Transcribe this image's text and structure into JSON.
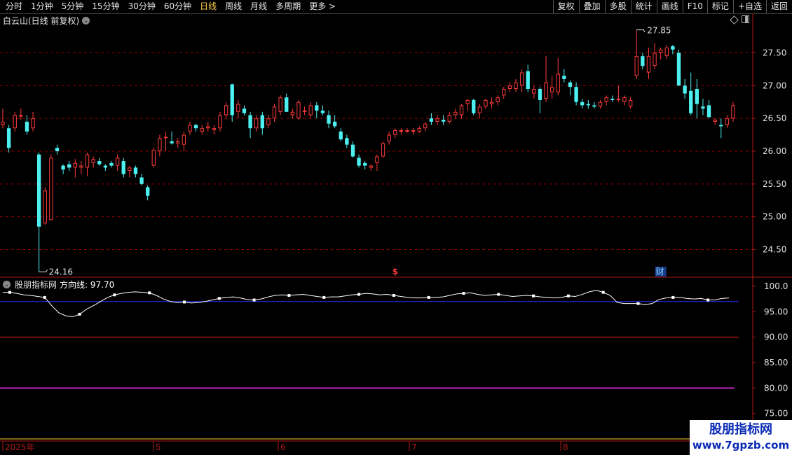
{
  "toolbar": {
    "periods": [
      "分时",
      "1分钟",
      "5分钟",
      "15分钟",
      "30分钟",
      "60分钟",
      "日线",
      "周线",
      "月线",
      "多周期",
      "更多 >"
    ],
    "active_period": "日线",
    "right_buttons": [
      "复权",
      "叠加",
      "多股",
      "统计",
      "画线",
      "F10",
      "标记",
      "+自选",
      "返回"
    ]
  },
  "chart_header": {
    "title": "白云山(日线 前复权)"
  },
  "indicator_header": {
    "name": "股朋指标网",
    "line_label": "方向线: 97.70"
  },
  "price_axis": [
    "27.50",
    "27.00",
    "26.50",
    "26.00",
    "25.50",
    "25.00",
    "24.50"
  ],
  "indicator_axis": [
    "100.0",
    "95.00",
    "90.00",
    "85.00",
    "80.00",
    "75.00"
  ],
  "markers": {
    "high_label": "27.85",
    "low_label": "24.16",
    "event_dollar": "$",
    "event_cai": "财"
  },
  "time_axis": [
    "2025年",
    "5",
    "6",
    "7",
    "8"
  ],
  "watermark": {
    "line1": "股朋指标网",
    "line2": "www.7gpzb.com"
  },
  "colors": {
    "up": "#ff3b3b",
    "down": "#4cf0f0",
    "grid": "#8b0000",
    "axis": "#b01818",
    "indicator_line": "#ffffff",
    "blue_level": "#2233ff",
    "magenta_level": "#ff33ff",
    "red_level": "#ff2222"
  },
  "chart_data": [
    {
      "type": "candlestick",
      "title": "白云山(日线 前复权)",
      "ylim": [
        24.1,
        27.9
      ],
      "yticks": [
        24.5,
        25.0,
        25.5,
        26.0,
        26.5,
        27.0,
        27.5
      ],
      "annotations": {
        "high": 27.85,
        "low": 24.16
      },
      "ohlc": [
        [
          26.4,
          26.65,
          26.35,
          26.45
        ],
        [
          26.35,
          26.4,
          25.98,
          26.05
        ],
        [
          26.35,
          26.6,
          26.3,
          26.55
        ],
        [
          26.55,
          26.65,
          26.48,
          26.55
        ],
        [
          26.45,
          26.55,
          26.25,
          26.3
        ],
        [
          26.35,
          26.6,
          26.3,
          26.5
        ],
        [
          25.95,
          25.98,
          24.16,
          24.85
        ],
        [
          24.9,
          25.45,
          24.88,
          25.4
        ],
        [
          24.95,
          25.95,
          24.95,
          25.9
        ],
        [
          26.05,
          26.1,
          25.95,
          26.0
        ],
        [
          25.78,
          25.8,
          25.65,
          25.72
        ],
        [
          25.8,
          25.85,
          25.7,
          25.75
        ],
        [
          25.75,
          25.88,
          25.6,
          25.82
        ],
        [
          25.75,
          25.85,
          25.65,
          25.78
        ],
        [
          25.75,
          25.98,
          25.62,
          25.95
        ],
        [
          25.82,
          25.92,
          25.75,
          25.88
        ],
        [
          25.85,
          25.9,
          25.78,
          25.8
        ],
        [
          25.78,
          25.8,
          25.7,
          25.75
        ],
        [
          25.82,
          25.85,
          25.75,
          25.78
        ],
        [
          25.78,
          25.95,
          25.7,
          25.9
        ],
        [
          25.85,
          25.9,
          25.6,
          25.65
        ],
        [
          25.7,
          25.78,
          25.6,
          25.75
        ],
        [
          25.75,
          25.78,
          25.6,
          25.65
        ],
        [
          25.6,
          25.65,
          25.48,
          25.5
        ],
        [
          25.45,
          25.48,
          25.25,
          25.32
        ],
        [
          25.78,
          26.05,
          25.75,
          26.02
        ],
        [
          26.0,
          26.25,
          25.92,
          26.2
        ],
        [
          26.2,
          26.3,
          26.0,
          26.22
        ],
        [
          26.15,
          26.3,
          26.1,
          26.12
        ],
        [
          26.12,
          26.2,
          26.05,
          26.15
        ],
        [
          26.1,
          26.3,
          26.0,
          26.25
        ],
        [
          26.3,
          26.45,
          26.25,
          26.4
        ],
        [
          26.4,
          26.42,
          26.3,
          26.35
        ],
        [
          26.3,
          26.4,
          26.25,
          26.35
        ],
        [
          26.35,
          26.45,
          26.3,
          26.38
        ],
        [
          26.32,
          26.4,
          26.25,
          26.35
        ],
        [
          26.35,
          26.6,
          26.3,
          26.55
        ],
        [
          26.55,
          26.75,
          26.5,
          26.7
        ],
        [
          27.02,
          27.03,
          26.45,
          26.55
        ],
        [
          26.6,
          26.78,
          26.5,
          26.72
        ],
        [
          26.65,
          26.7,
          26.55,
          26.58
        ],
        [
          26.55,
          26.6,
          26.2,
          26.35
        ],
        [
          26.35,
          26.55,
          26.3,
          26.5
        ],
        [
          26.55,
          26.6,
          26.25,
          26.35
        ],
        [
          26.4,
          26.55,
          26.35,
          26.5
        ],
        [
          26.5,
          26.72,
          26.45,
          26.68
        ],
        [
          26.6,
          26.85,
          26.55,
          26.82
        ],
        [
          26.82,
          26.88,
          26.6,
          26.6
        ],
        [
          26.55,
          26.65,
          26.5,
          26.6
        ],
        [
          26.5,
          26.78,
          26.48,
          26.75
        ],
        [
          26.6,
          26.68,
          26.55,
          26.62
        ],
        [
          26.55,
          26.75,
          26.5,
          26.7
        ],
        [
          26.7,
          26.75,
          26.5,
          26.62
        ],
        [
          26.62,
          26.7,
          26.55,
          26.58
        ],
        [
          26.55,
          26.62,
          26.35,
          26.42
        ],
        [
          26.45,
          26.55,
          26.35,
          26.38
        ],
        [
          26.3,
          26.35,
          26.15,
          26.18
        ],
        [
          26.2,
          26.25,
          26.05,
          26.1
        ],
        [
          26.1,
          26.15,
          25.9,
          25.92
        ],
        [
          25.9,
          25.95,
          25.75,
          25.78
        ],
        [
          25.82,
          25.85,
          25.72,
          25.78
        ],
        [
          25.75,
          25.8,
          25.7,
          25.78
        ],
        [
          25.82,
          25.95,
          25.7,
          25.92
        ],
        [
          25.92,
          26.15,
          25.9,
          26.12
        ],
        [
          26.15,
          26.3,
          26.1,
          26.25
        ],
        [
          26.25,
          26.35,
          26.2,
          26.32
        ],
        [
          26.3,
          26.35,
          26.25,
          26.32
        ],
        [
          26.3,
          26.35,
          26.28,
          26.32
        ],
        [
          26.3,
          26.35,
          26.25,
          26.32
        ],
        [
          26.3,
          26.38,
          26.28,
          26.35
        ],
        [
          26.35,
          26.45,
          26.3,
          26.42
        ],
        [
          26.5,
          26.58,
          26.4,
          26.45
        ],
        [
          26.45,
          26.55,
          26.4,
          26.5
        ],
        [
          26.48,
          26.55,
          26.4,
          26.45
        ],
        [
          26.45,
          26.6,
          26.42,
          26.55
        ],
        [
          26.55,
          26.65,
          26.5,
          26.6
        ],
        [
          26.55,
          26.72,
          26.5,
          26.7
        ],
        [
          26.72,
          26.8,
          26.62,
          26.78
        ],
        [
          26.78,
          26.8,
          26.55,
          26.58
        ],
        [
          26.58,
          26.72,
          26.5,
          26.68
        ],
        [
          26.68,
          26.8,
          26.65,
          26.78
        ],
        [
          26.72,
          26.82,
          26.65,
          26.75
        ],
        [
          26.75,
          26.85,
          26.7,
          26.82
        ],
        [
          26.85,
          26.98,
          26.8,
          26.95
        ],
        [
          26.95,
          27.05,
          26.9,
          27.0
        ],
        [
          26.95,
          27.1,
          26.9,
          27.05
        ],
        [
          27.0,
          27.25,
          26.9,
          27.2
        ],
        [
          27.22,
          27.32,
          26.9,
          26.95
        ],
        [
          26.88,
          27.0,
          26.8,
          26.95
        ],
        [
          26.95,
          26.98,
          26.58,
          26.78
        ],
        [
          26.8,
          27.45,
          26.75,
          27.05
        ],
        [
          26.9,
          27.15,
          26.8,
          26.98
        ],
        [
          26.9,
          27.42,
          26.85,
          27.18
        ],
        [
          27.15,
          27.25,
          27.05,
          27.1
        ],
        [
          27.05,
          27.08,
          26.85,
          26.98
        ],
        [
          26.98,
          27.05,
          26.7,
          26.75
        ],
        [
          26.75,
          26.8,
          26.65,
          26.7
        ],
        [
          26.72,
          26.78,
          26.65,
          26.7
        ],
        [
          26.7,
          26.75,
          26.65,
          26.68
        ],
        [
          26.68,
          26.78,
          26.65,
          26.75
        ],
        [
          26.75,
          26.85,
          26.7,
          26.82
        ],
        [
          26.8,
          26.85,
          26.75,
          26.78
        ],
        [
          26.78,
          27.0,
          26.75,
          26.8
        ],
        [
          26.75,
          26.85,
          26.7,
          26.82
        ],
        [
          26.68,
          26.82,
          26.65,
          26.78
        ],
        [
          27.15,
          27.85,
          27.1,
          27.45
        ],
        [
          27.45,
          27.5,
          27.25,
          27.3
        ],
        [
          27.2,
          27.58,
          27.1,
          27.45
        ],
        [
          27.3,
          27.65,
          27.25,
          27.5
        ],
        [
          27.5,
          27.58,
          27.4,
          27.55
        ],
        [
          27.45,
          27.62,
          27.4,
          27.58
        ],
        [
          27.6,
          27.62,
          27.48,
          27.55
        ],
        [
          27.5,
          27.55,
          27.0,
          27.0
        ],
        [
          27.0,
          27.1,
          26.8,
          26.88
        ],
        [
          26.92,
          27.2,
          26.55,
          26.58
        ],
        [
          26.95,
          27.1,
          26.5,
          26.72
        ],
        [
          26.68,
          26.8,
          26.55,
          26.65
        ],
        [
          26.7,
          26.78,
          26.5,
          26.52
        ],
        [
          26.45,
          26.5,
          26.4,
          26.48
        ],
        [
          26.4,
          26.5,
          26.2,
          26.38
        ],
        [
          26.4,
          26.55,
          26.35,
          26.5
        ],
        [
          26.5,
          26.75,
          26.45,
          26.7
        ]
      ]
    },
    {
      "type": "line",
      "series": [
        {
          "name": "方向线",
          "values": [
            98.8,
            98.8,
            98.6,
            98.3,
            98.2,
            98.0,
            97.8,
            96.2,
            94.8,
            94.2,
            94.0,
            94.5,
            95.5,
            96.2,
            97.0,
            97.8,
            98.3,
            98.6,
            98.8,
            98.9,
            98.8,
            98.7,
            98.2,
            97.5,
            97.0,
            96.8,
            96.9,
            96.7,
            96.8,
            97.0,
            97.3,
            97.6,
            97.8,
            97.9,
            97.7,
            97.4,
            97.3,
            97.5,
            97.9,
            98.2,
            98.3,
            98.2,
            98.3,
            98.4,
            98.2,
            98.0,
            97.8,
            97.9,
            97.9,
            98.1,
            98.3,
            98.4,
            98.6,
            98.5,
            98.3,
            98.4,
            98.2,
            98.0,
            97.8,
            97.7,
            97.7,
            97.8,
            97.8,
            97.9,
            98.2,
            98.5,
            98.6,
            98.7,
            98.4,
            98.2,
            98.3,
            98.4,
            98.2,
            98.0,
            98.1,
            98.2,
            98.1,
            97.9,
            97.8,
            97.7,
            97.8,
            98.1,
            98.0,
            98.4,
            98.9,
            99.2,
            98.8,
            98.2,
            96.8,
            96.6,
            96.6,
            96.6,
            96.4,
            96.6,
            97.4,
            97.7,
            97.8,
            97.8,
            97.6,
            97.5,
            97.6,
            97.3,
            97.3,
            97.6,
            97.7
          ]
        }
      ],
      "ylim": [
        74.0,
        101.5
      ],
      "yticks": [
        75,
        80,
        85,
        90,
        95,
        100
      ],
      "levels": {
        "blue": 97.0,
        "red": 90.0,
        "magenta": 80.0
      }
    }
  ]
}
